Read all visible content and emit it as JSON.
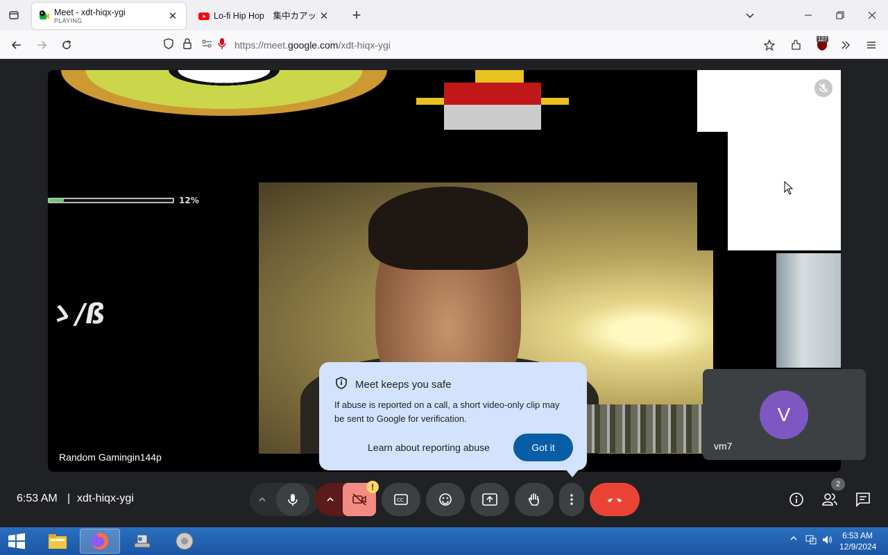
{
  "browser": {
    "tabs": [
      {
        "title": "Meet - xdt-hiqx-ygi",
        "subtitle": "PLAYING",
        "active": true
      },
      {
        "title": "Lo-fi Hip Hop　集中カアップ!",
        "subtitle": "",
        "active": false
      }
    ],
    "url_prefix": "https://meet.",
    "url_domain": "google.com",
    "url_path": "/xdt-hiqx-ygi",
    "extension_badge": "127"
  },
  "meet": {
    "main_participant": "Random Gamingin144p",
    "self_name": "vm7",
    "self_avatar_letter": "V",
    "overlay_progress_label": "12%",
    "overlay_progress_value": 0.12,
    "overlay_logo_text": "ゝ/ß",
    "popup": {
      "title": "Meet keeps you safe",
      "body": "If abuse is reported on a call, a short video-only clip may be sent to Google for verification.",
      "learn_link": "Learn about reporting abuse",
      "ok_button": "Got it"
    },
    "time": "6:53 AM",
    "separator": "|",
    "meeting_code": "xdt-hiqx-ygi",
    "camera_warning_badge": "!",
    "participants_count": "2"
  },
  "taskbar": {
    "clock_time": "6:53 AM",
    "clock_date": "12/9/2024"
  },
  "colors": {
    "meet_bg": "#202124",
    "popup_bg": "#d3e3fd",
    "got_it": "#075ea6",
    "end_call": "#ea4335",
    "avatar": "#7e57c2"
  }
}
